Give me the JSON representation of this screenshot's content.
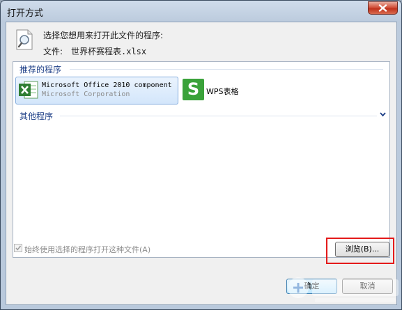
{
  "window": {
    "title": "打开方式",
    "close_icon": "close-icon"
  },
  "header": {
    "prompt": "选择您想用来打开此文件的程序:",
    "file_label": "文件:",
    "file_name": "世界杯赛程表.xlsx",
    "icon": "document-search-icon"
  },
  "recommended": {
    "title": "推荐的程序",
    "apps": [
      {
        "name": "Microsoft Office 2010 component",
        "company": "Microsoft Corporation",
        "icon": "excel-icon",
        "selected": true
      },
      {
        "name": "WPS表格",
        "icon": "wps-spreadsheet-icon",
        "selected": false
      }
    ]
  },
  "other": {
    "title": "其他程序",
    "icon": "chevron-down-icon",
    "expanded": false
  },
  "always_use": {
    "label": "始终使用选择的程序打开这种文件(A)",
    "checked": true,
    "enabled": false
  },
  "buttons": {
    "browse": "浏览(B)...",
    "ok": "确定",
    "cancel": "取消"
  },
  "colors": {
    "highlight": "#e41a1a",
    "group_title": "#1e3f87",
    "wps_green": "#3aa23a",
    "excel_green": "#2e7d32"
  }
}
